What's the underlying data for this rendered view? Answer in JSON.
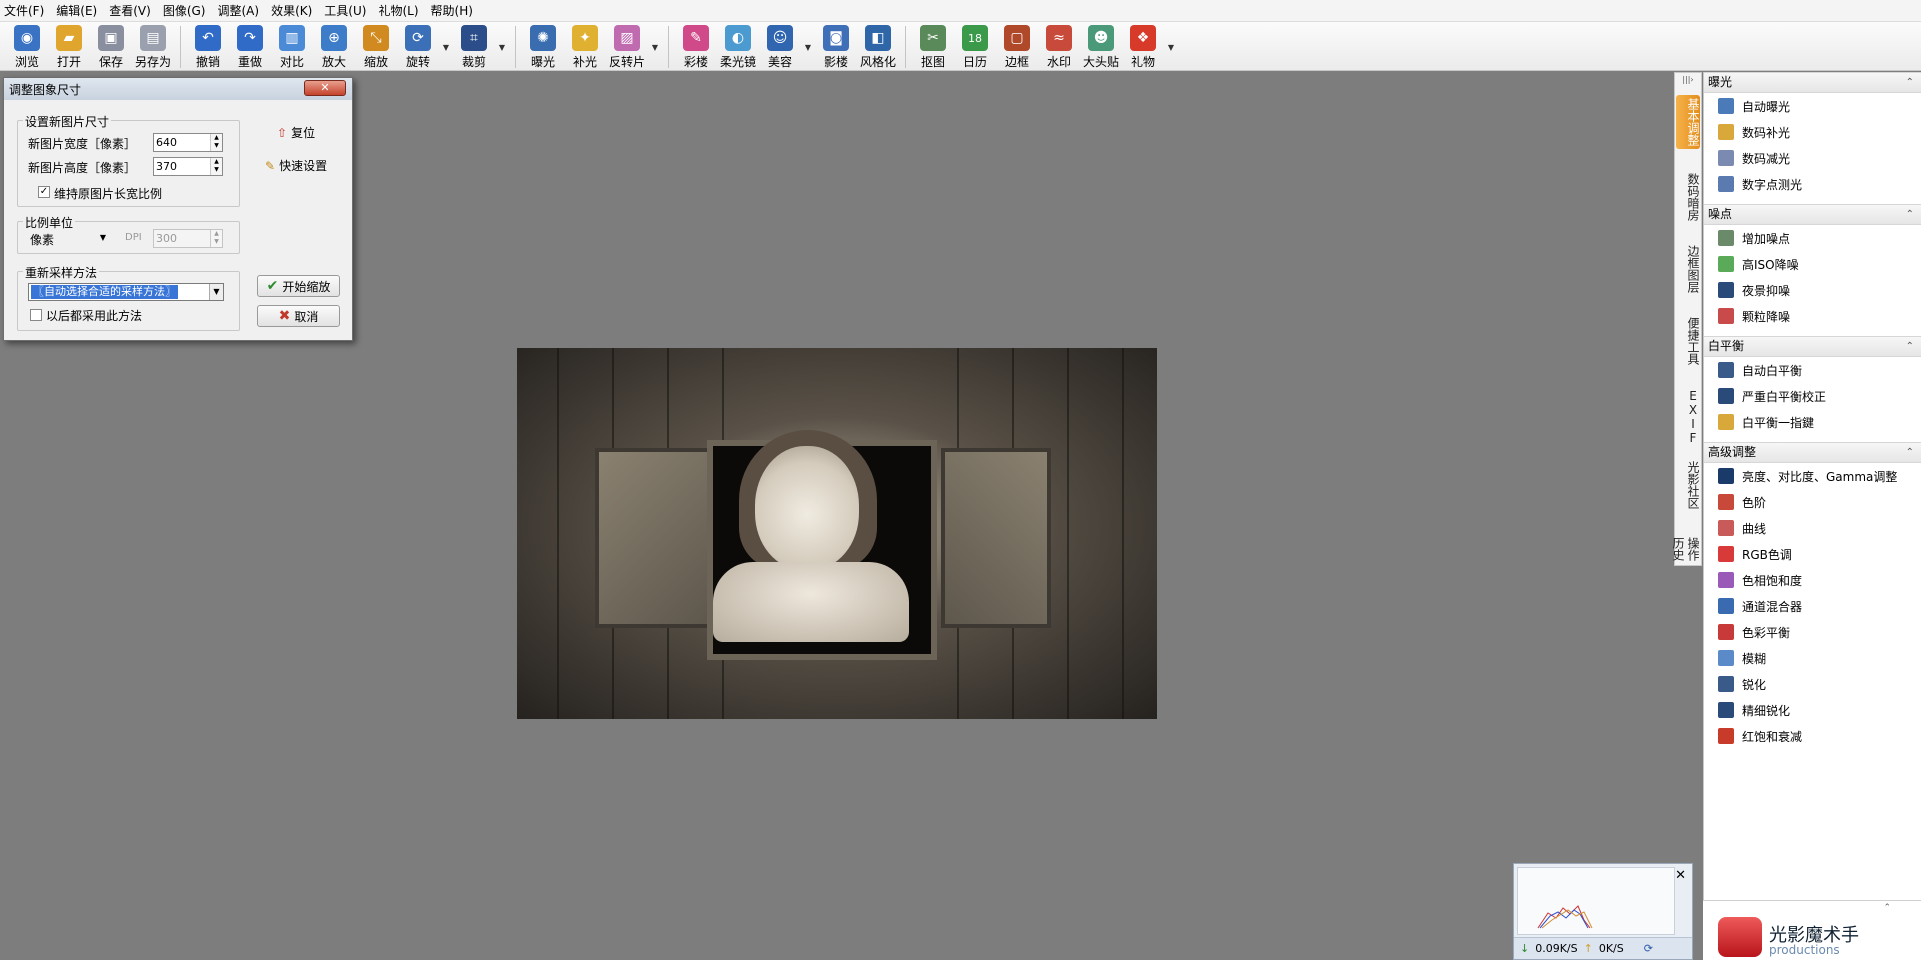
{
  "menubar": {
    "items": [
      "文件(F)",
      "编辑(E)",
      "查看(V)",
      "图像(G)",
      "调整(A)",
      "效果(K)",
      "工具(U)",
      "礼物(L)",
      "帮助(H)"
    ]
  },
  "toolbar": {
    "buttons": [
      {
        "label": "浏览",
        "icon": "browse-icon",
        "color": "#3b73c4"
      },
      {
        "label": "打开",
        "icon": "folder-open-icon",
        "color": "#e0a52c"
      },
      {
        "label": "保存",
        "icon": "save-icon",
        "color": "#8a8fa0"
      },
      {
        "label": "另存为",
        "icon": "save-as-icon",
        "color": "#9aa0ad"
      },
      {
        "label": "撤销",
        "icon": "undo-icon",
        "color": "#2f6bc7"
      },
      {
        "label": "重做",
        "icon": "redo-icon",
        "color": "#2f6bc7"
      },
      {
        "label": "对比",
        "icon": "compare-icon",
        "color": "#4a8ad6"
      },
      {
        "label": "放大",
        "icon": "zoom-in-icon",
        "color": "#3c7cc8"
      },
      {
        "label": "缩放",
        "icon": "resize-icon",
        "color": "#d18a1f"
      },
      {
        "label": "旋转",
        "icon": "rotate-icon",
        "color": "#3b6fb8"
      },
      {
        "label": "裁剪",
        "icon": "crop-icon",
        "color": "#2b4e8a"
      },
      {
        "label": "曝光",
        "icon": "exposure-icon",
        "color": "#3a6cb0"
      },
      {
        "label": "补光",
        "icon": "fill-light-icon",
        "color": "#e0b030"
      },
      {
        "label": "反转片",
        "icon": "reversal-film-icon",
        "color": "#c06ab0"
      },
      {
        "label": "彩楼",
        "icon": "color-pen-icon",
        "color": "#d04a8a"
      },
      {
        "label": "柔光镜",
        "icon": "soft-light-icon",
        "color": "#4c9bd0"
      },
      {
        "label": "美容",
        "icon": "beauty-icon",
        "color": "#3066b0"
      },
      {
        "label": "影楼",
        "icon": "studio-icon",
        "color": "#3f6fb6"
      },
      {
        "label": "风格化",
        "icon": "stylize-icon",
        "color": "#2e66a8"
      },
      {
        "label": "抠图",
        "icon": "cutout-icon",
        "color": "#5a8a5a"
      },
      {
        "label": "日历",
        "icon": "calendar-icon",
        "color": "#3a9a4a"
      },
      {
        "label": "边框",
        "icon": "frame-icon",
        "color": "#b0482a"
      },
      {
        "label": "水印",
        "icon": "watermark-icon",
        "color": "#c84a3a"
      },
      {
        "label": "大头贴",
        "icon": "photo-sticker-icon",
        "color": "#4a9a7a"
      },
      {
        "label": "礼物",
        "icon": "gift-icon",
        "color": "#d83a2a"
      }
    ],
    "calendar_day": "18"
  },
  "dialog": {
    "title": "调整图象尺寸",
    "close_label": "✕",
    "new_size_group": "设置新图片尺寸",
    "width_label": "新图片宽度［像素］",
    "width_value": "640",
    "height_label": "新图片高度［像素］",
    "height_value": "370",
    "keep_ratio_label": "维持原图片长宽比例",
    "keep_ratio_checked": true,
    "reset_label": "复位",
    "quick_settings_label": "快速设置",
    "unit_group": "比例单位",
    "unit_value": "像素",
    "dpi_label": "DPI",
    "dpi_value": "300",
    "resample_group": "重新采样方法",
    "resample_value": "〖自动选择合适的采样方法〗",
    "always_use_label": "以后都采用此方法",
    "always_use_checked": false,
    "start_label": "开始缩放",
    "cancel_label": "取消"
  },
  "right_tabs": [
    "基本调整",
    "数码暗房",
    "边框图层",
    "便捷工具",
    "EXIF",
    "光影社区",
    "操作历史"
  ],
  "right_panel": {
    "sections": [
      {
        "title": "曝光",
        "items": [
          {
            "label": "自动曝光",
            "icon": "auto-exposure-icon",
            "color": "#4a7ab8"
          },
          {
            "label": "数码补光",
            "icon": "digital-fill-light-icon",
            "color": "#d9a83a"
          },
          {
            "label": "数码减光",
            "icon": "digital-reduce-light-icon",
            "color": "#7a8ab0"
          },
          {
            "label": "数字点测光",
            "icon": "spot-metering-icon",
            "color": "#5a7ab0"
          }
        ]
      },
      {
        "title": "噪点",
        "items": [
          {
            "label": "增加噪点",
            "icon": "add-noise-icon",
            "color": "#6a8a6a"
          },
          {
            "label": "高ISO降噪",
            "icon": "high-iso-denoise-icon",
            "color": "#5aaa5a"
          },
          {
            "label": "夜景抑噪",
            "icon": "night-denoise-icon",
            "color": "#2a4a7a"
          },
          {
            "label": "颗粒降噪",
            "icon": "grain-denoise-icon",
            "color": "#c84a4a"
          }
        ]
      },
      {
        "title": "白平衡",
        "items": [
          {
            "label": "自动白平衡",
            "icon": "auto-white-balance-icon",
            "color": "#3a5a8a"
          },
          {
            "label": "严重白平衡校正",
            "icon": "white-balance-correct-icon",
            "color": "#2a4a7a"
          },
          {
            "label": "白平衡一指鍵",
            "icon": "white-balance-one-click-icon",
            "color": "#d9a83a"
          }
        ]
      },
      {
        "title": "高级调整",
        "items": [
          {
            "label": "亮度、对比度、Gamma调整",
            "icon": "brightness-contrast-icon",
            "color": "#1a3a6a"
          },
          {
            "label": "色阶",
            "icon": "levels-icon",
            "color": "#c8483a"
          },
          {
            "label": "曲线",
            "icon": "curves-icon",
            "color": "#c85a5a"
          },
          {
            "label": "RGB色调",
            "icon": "rgb-tone-icon",
            "color": "#d83a3a"
          },
          {
            "label": "色相饱和度",
            "icon": "hue-saturation-icon",
            "color": "#9a5ab8"
          },
          {
            "label": "通道混合器",
            "icon": "channel-mixer-icon",
            "color": "#3a6ab0"
          },
          {
            "label": "色彩平衡",
            "icon": "color-balance-icon",
            "color": "#c83a3a"
          },
          {
            "label": "模糊",
            "icon": "blur-icon",
            "color": "#5a8ac8"
          },
          {
            "label": "锐化",
            "icon": "sharpen-icon",
            "color": "#3a5a8a"
          },
          {
            "label": "精细锐化",
            "icon": "fine-sharpen-icon",
            "color": "#2a4a7a"
          },
          {
            "label": "红饱和衰减",
            "icon": "red-saturation-icon",
            "color": "#c83a2a"
          }
        ]
      }
    ]
  },
  "logo": {
    "name": "光影魔术手",
    "sub": "productions"
  },
  "histogram": {
    "download": "0.09K/S",
    "upload": "0K/S",
    "close": "✕"
  }
}
